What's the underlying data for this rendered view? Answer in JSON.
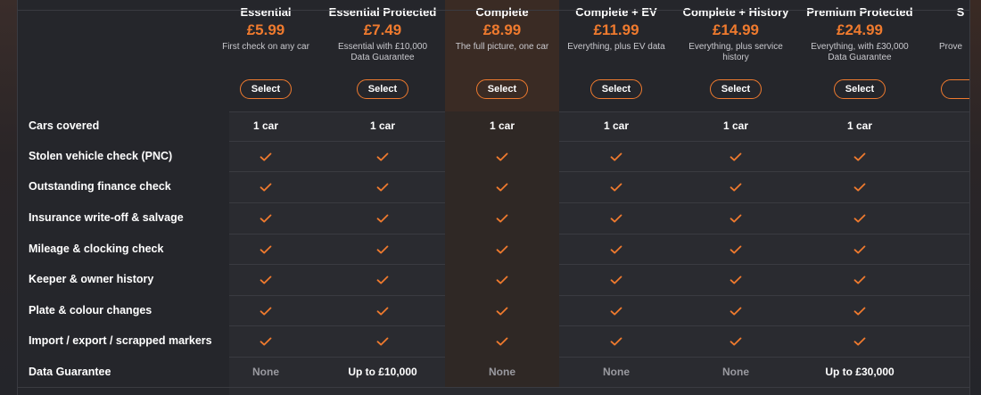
{
  "plans": [
    {
      "name": "Essential",
      "price": "£5.99",
      "desc": "First check on any car",
      "select": "Select"
    },
    {
      "name": "Essential Protected",
      "price": "£7.49",
      "desc": "Essential with £10,000 Data Guarantee",
      "select": "Select"
    },
    {
      "name": "Complete",
      "price": "£8.99",
      "desc": "The full picture, one car",
      "select": "Select"
    },
    {
      "name": "Complete + EV",
      "price": "£11.99",
      "desc": "Everything, plus EV data",
      "select": "Select"
    },
    {
      "name": "Complete + History",
      "price": "£14.99",
      "desc": "Everything, plus service history",
      "select": "Select"
    },
    {
      "name": "Premium Protected",
      "price": "£24.99",
      "desc": "Everything, with £30,000 Data Guarantee",
      "select": "Select"
    },
    {
      "name": "S",
      "price": "",
      "desc": "Prove",
      "select": ""
    }
  ],
  "rows": [
    {
      "label": "Cars covered",
      "type": "text",
      "values": [
        "1 car",
        "1 car",
        "1 car",
        "1 car",
        "1 car",
        "1 car"
      ]
    },
    {
      "label": "Stolen vehicle check (PNC)",
      "type": "check"
    },
    {
      "label": "Outstanding finance check",
      "type": "check"
    },
    {
      "label": "Insurance write-off & salvage",
      "type": "check"
    },
    {
      "label": "Mileage & clocking check",
      "type": "check"
    },
    {
      "label": "Keeper & owner history",
      "type": "check"
    },
    {
      "label": "Plate & colour changes",
      "type": "check"
    },
    {
      "label": "Import / export / scrapped markers",
      "type": "check"
    },
    {
      "label": "Data Guarantee",
      "type": "text",
      "values": [
        "None",
        "Up to £10,000",
        "None",
        "None",
        "None",
        "Up to £30,000"
      ]
    }
  ],
  "colors": {
    "accent": "#ef7a2e",
    "highlight": "#3a2b24"
  },
  "icons": {
    "check": "check-icon"
  }
}
